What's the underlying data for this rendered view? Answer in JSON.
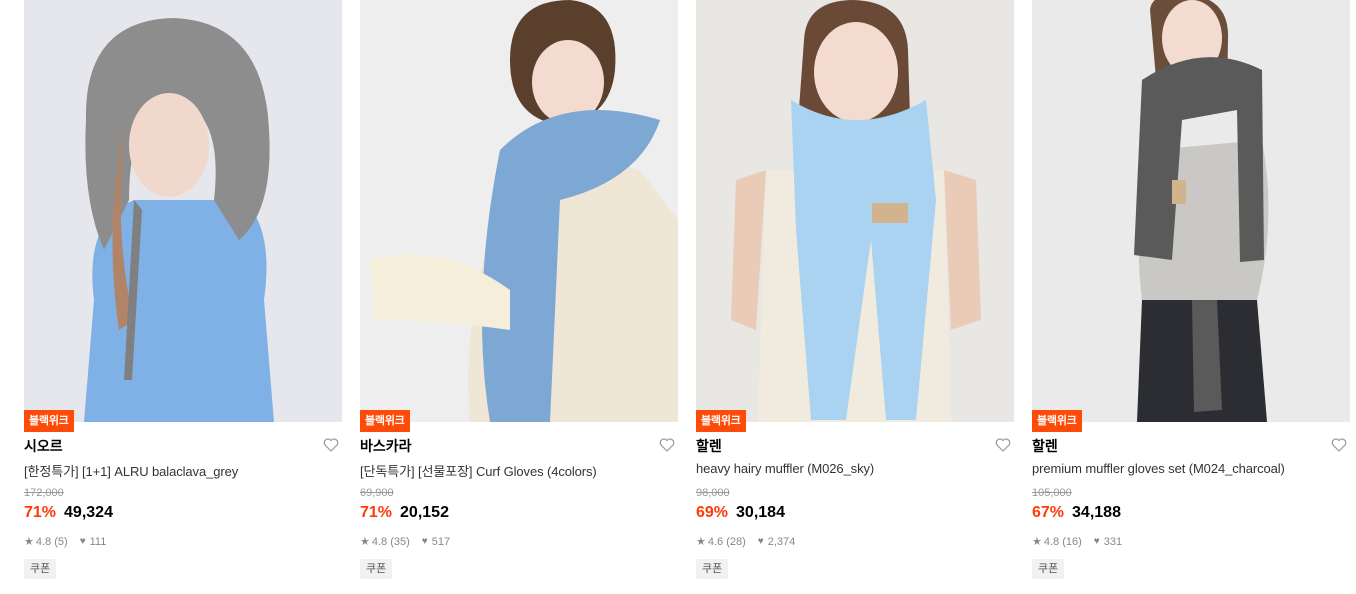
{
  "products": [
    {
      "badge": "블랙위크",
      "brand": "시오르",
      "name": "[한정특가] [1+1] ALRU balaclava_grey",
      "original_price": "172,000",
      "discount": "71%",
      "price": "49,324",
      "rating": "4.8",
      "reviews": "(5)",
      "likes": "111",
      "coupon": "쿠폰",
      "photo_colors": {
        "bg": "#e6e7ec",
        "garment": "#7fb0e6",
        "accessory": "#8d8d8d"
      }
    },
    {
      "badge": "블랙위크",
      "brand": "바스카라",
      "name": "[단독특가] [선물포장] Curf Gloves (4colors)",
      "original_price": "69,900",
      "discount": "71%",
      "price": "20,152",
      "rating": "4.8",
      "reviews": "(35)",
      "likes": "517",
      "coupon": "쿠폰",
      "photo_colors": {
        "bg": "#eeeeee",
        "garment": "#efe6d6",
        "accessory": "#7ea8d4"
      }
    },
    {
      "badge": "블랙위크",
      "brand": "할렌",
      "name": "heavy hairy muffler (M026_sky)",
      "original_price": "98,000",
      "discount": "69%",
      "price": "30,184",
      "rating": "4.6",
      "reviews": "(28)",
      "likes": "2,374",
      "coupon": "쿠폰",
      "photo_colors": {
        "bg": "#e9e7e4",
        "garment": "#f1ebdf",
        "accessory": "#a9d3f0"
      }
    },
    {
      "badge": "블랙위크",
      "brand": "할렌",
      "name": "premium muffler gloves set (M024_charcoal)",
      "original_price": "105,000",
      "discount": "67%",
      "price": "34,188",
      "rating": "4.8",
      "reviews": "(16)",
      "likes": "331",
      "coupon": "쿠폰",
      "photo_colors": {
        "bg": "#eaeaea",
        "garment": "#c9c8c4",
        "accessory": "#5a5a5a"
      }
    }
  ],
  "icons": {
    "wishlist": "heart-outline-icon",
    "rating": "star-icon",
    "likes": "heart-filled-icon"
  },
  "colors": {
    "accent": "#ff4b0a",
    "discount": "#ff3b0a"
  }
}
